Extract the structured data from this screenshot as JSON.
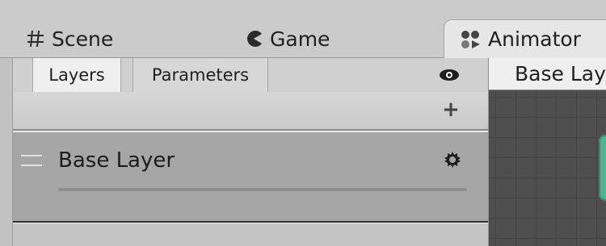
{
  "tabs": {
    "scene": {
      "label": "Scene",
      "icon": "hash-icon"
    },
    "game": {
      "label": "Game",
      "icon": "pacman-icon"
    },
    "animator": {
      "label": "Animator",
      "icon": "animator-icon"
    }
  },
  "animator_panel": {
    "subtabs": [
      {
        "label": "Layers",
        "active": true
      },
      {
        "label": "Parameters",
        "active": false
      }
    ],
    "toolbar": {
      "visibility_icon": "eye-icon",
      "add_icon": "plus-icon"
    },
    "layers": [
      {
        "name": "Base Layer",
        "settings_icon": "gear-icon",
        "handle_icon": "drag-handle-icon"
      }
    ]
  },
  "graph": {
    "breadcrumb": "Base Layer",
    "colors": {
      "grid_bg": "#4e4e4e",
      "state_node": "#4cb48f"
    }
  }
}
